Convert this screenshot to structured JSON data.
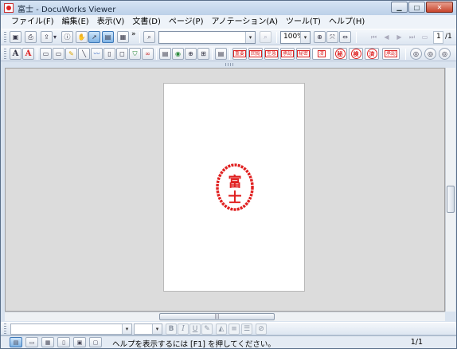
{
  "window": {
    "title": "富士 - DocuWorks Viewer",
    "controls": [
      "minimize",
      "maximize",
      "close"
    ]
  },
  "menu": [
    "ファイル(F)",
    "編集(E)",
    "表示(V)",
    "文書(D)",
    "ページ(P)",
    "アノテーション(A)",
    "ツール(T)",
    "ヘルプ(H)"
  ],
  "toolbar": {
    "zoom_value": "100%",
    "search_value": "",
    "page_indicator": "1",
    "page_total": "/1",
    "more_glyph": "»"
  },
  "annotation_tools": {
    "text_a_black": "A",
    "text_a_red": "A"
  },
  "stamps": {
    "mini": [
      "重要",
      "回覧",
      "至急",
      "承認",
      "秘密",
      "済"
    ],
    "round": [
      "秘",
      "検",
      "済"
    ],
    "last_mini": "承認"
  },
  "document": {
    "stamp_text": "富士",
    "stamp_color": "#e02020"
  },
  "text_toolbar": {
    "font_name": "",
    "font_size": "",
    "bold": "B",
    "italic": "I",
    "underline": "U"
  },
  "status": {
    "message": "ヘルプを表示するには [F1] を押してください。",
    "page": "1/1"
  }
}
